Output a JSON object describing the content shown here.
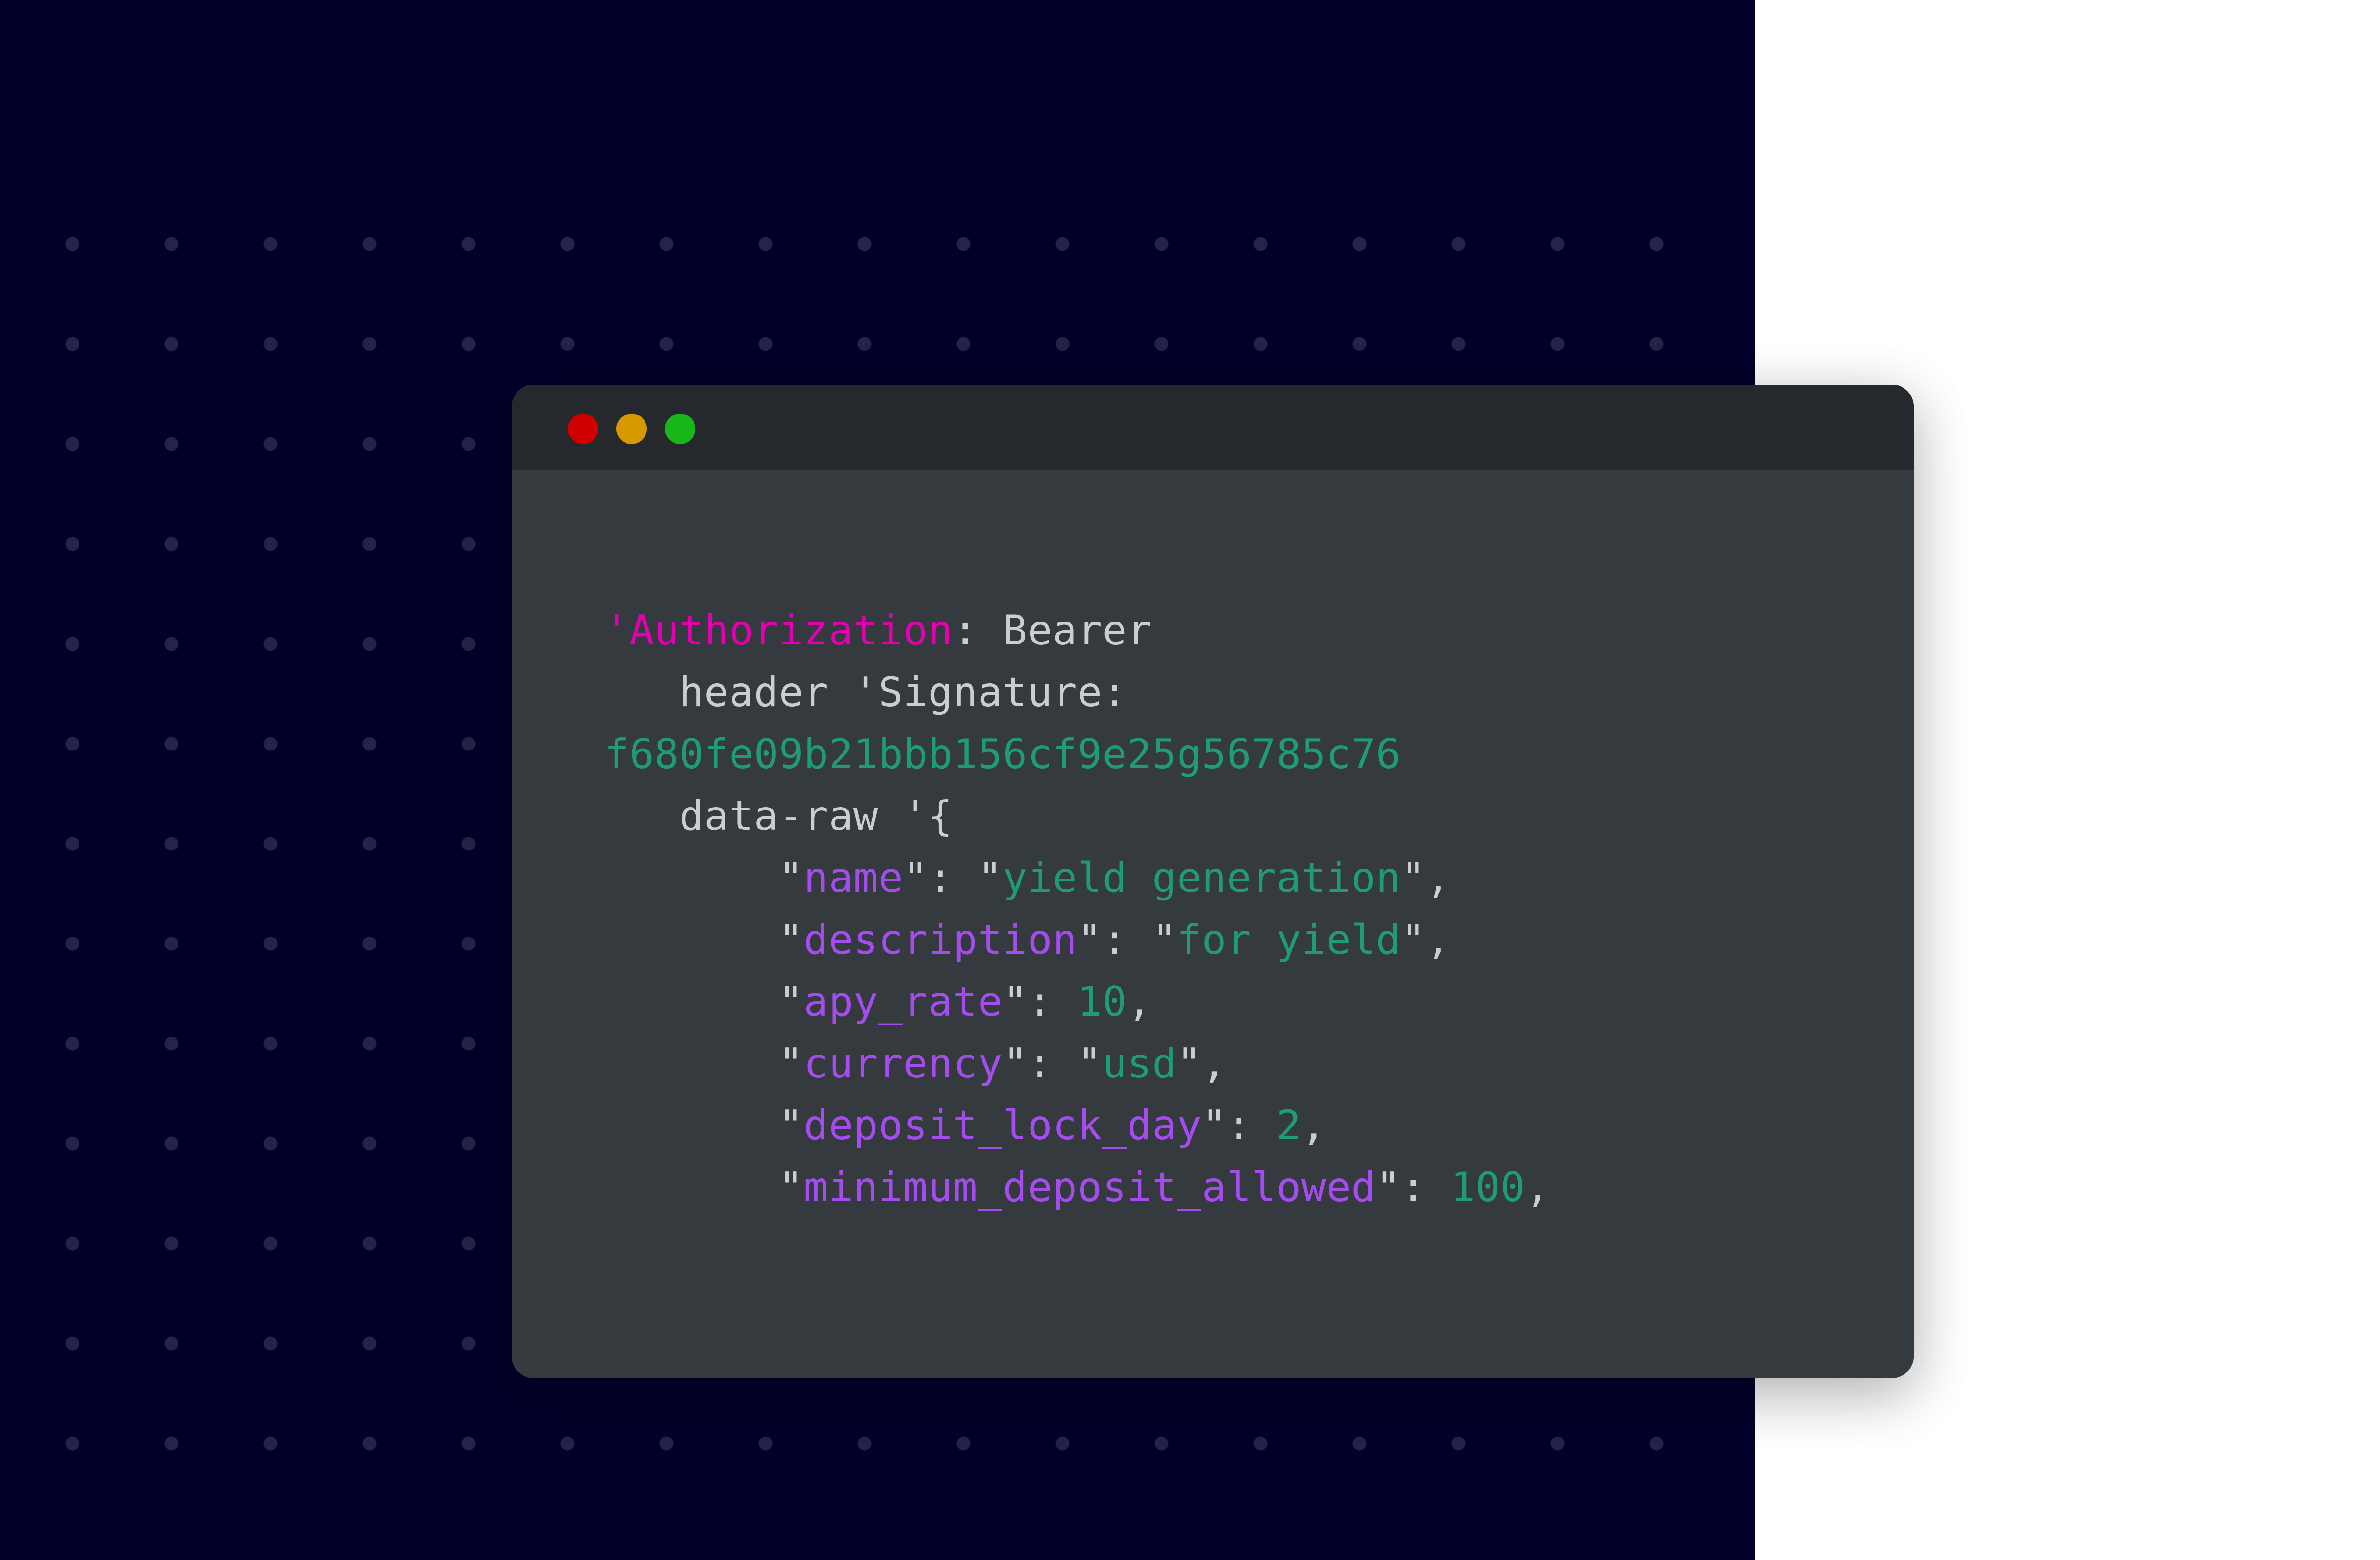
{
  "colors": {
    "page_bg": "#ffffff",
    "dark_bg": "#01002a",
    "dot": "#25264a",
    "window_bg": "#353a3e",
    "titlebar_bg": "#25282c",
    "plain_text": "#c9ced3",
    "magenta": "#e300b0",
    "green": "#1f9c73",
    "purple": "#a54cf0",
    "red": "#d10000",
    "yellow": "#d69a00",
    "green_dot": "#18b81a"
  },
  "window": {
    "controls": [
      {
        "name": "close-icon",
        "color": "#d10000"
      },
      {
        "name": "minimize-icon",
        "color": "#d69a00"
      },
      {
        "name": "maximize-icon",
        "color": "#18b81a"
      }
    ]
  },
  "code": {
    "lines": [
      [
        {
          "text": "'Authorization",
          "color": "#e300b0"
        },
        {
          "text": ": Bearer",
          "color": "#c9ced3"
        }
      ],
      [
        {
          "text": "   header 'Signature:",
          "color": "#c9ced3"
        }
      ],
      [
        {
          "text": "f680fe09b21bbb156cf9e25g56785c76",
          "color": "#1f9c73"
        }
      ],
      [
        {
          "text": "   data-raw '{",
          "color": "#c9ced3"
        }
      ],
      [
        {
          "text": "       \"",
          "color": "#c9ced3"
        },
        {
          "text": "name",
          "color": "#a54cf0"
        },
        {
          "text": "\": \"",
          "color": "#c9ced3"
        },
        {
          "text": "yield generation",
          "color": "#1f9c73"
        },
        {
          "text": "\",",
          "color": "#c9ced3"
        }
      ],
      [
        {
          "text": "       \"",
          "color": "#c9ced3"
        },
        {
          "text": "description",
          "color": "#a54cf0"
        },
        {
          "text": "\": \"",
          "color": "#c9ced3"
        },
        {
          "text": "for yield",
          "color": "#1f9c73"
        },
        {
          "text": "\",",
          "color": "#c9ced3"
        }
      ],
      [
        {
          "text": "       \"",
          "color": "#c9ced3"
        },
        {
          "text": "apy_rate",
          "color": "#a54cf0"
        },
        {
          "text": "\": ",
          "color": "#c9ced3"
        },
        {
          "text": "10",
          "color": "#1f9c73"
        },
        {
          "text": ",",
          "color": "#c9ced3"
        }
      ],
      [
        {
          "text": "       \"",
          "color": "#c9ced3"
        },
        {
          "text": "currency",
          "color": "#a54cf0"
        },
        {
          "text": "\": \"",
          "color": "#c9ced3"
        },
        {
          "text": "usd",
          "color": "#1f9c73"
        },
        {
          "text": "\",",
          "color": "#c9ced3"
        }
      ],
      [
        {
          "text": "       \"",
          "color": "#c9ced3"
        },
        {
          "text": "deposit_lock_day",
          "color": "#a54cf0"
        },
        {
          "text": "\": ",
          "color": "#c9ced3"
        },
        {
          "text": "2",
          "color": "#1f9c73"
        },
        {
          "text": ",",
          "color": "#c9ced3"
        }
      ],
      [
        {
          "text": "       \"",
          "color": "#c9ced3"
        },
        {
          "text": "minimum_deposit_allowed",
          "color": "#a54cf0"
        },
        {
          "text": "\": ",
          "color": "#c9ced3"
        },
        {
          "text": "100",
          "color": "#1f9c73"
        },
        {
          "text": ",",
          "color": "#c9ced3"
        }
      ]
    ]
  }
}
